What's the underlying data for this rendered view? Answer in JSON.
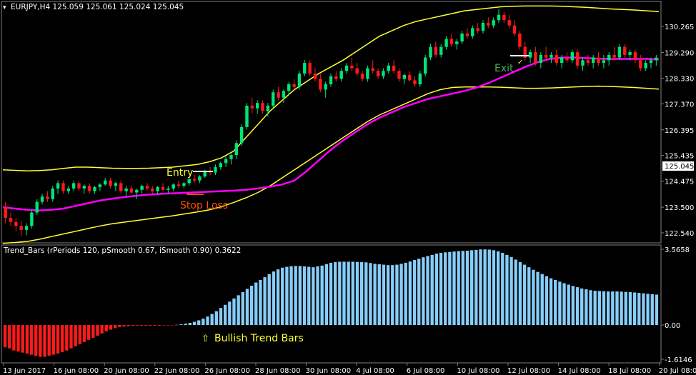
{
  "chart_data": [
    {
      "type": "candlestick",
      "header": "EURJPY,H4  125.059 125.061 125.024 125.045",
      "current_price": "125.045",
      "y_ticks": [
        "130.265",
        "129.290",
        "128.330",
        "127.370",
        "126.395",
        "125.435",
        "124.475",
        "123.500",
        "122.540"
      ],
      "y_tick_values": [
        130.265,
        129.29,
        128.33,
        127.37,
        126.395,
        125.435,
        124.475,
        123.5,
        122.54
      ],
      "ylim": [
        122.4,
        131.0
      ],
      "annotations": [
        "Entry",
        "Stop Loss",
        "Exit"
      ],
      "candles": [
        [
          123.5,
          123.7,
          122.9,
          123.1
        ],
        [
          123.1,
          123.3,
          122.8,
          122.95
        ],
        [
          122.95,
          123.1,
          122.6,
          122.8
        ],
        [
          122.8,
          123.0,
          122.4,
          122.65
        ],
        [
          122.65,
          122.9,
          122.45,
          122.8
        ],
        [
          122.8,
          123.4,
          122.7,
          123.3
        ],
        [
          123.3,
          123.8,
          123.2,
          123.7
        ],
        [
          123.7,
          124.0,
          123.6,
          123.9
        ],
        [
          123.9,
          124.1,
          123.7,
          123.8
        ],
        [
          123.8,
          124.3,
          123.7,
          124.2
        ],
        [
          124.2,
          124.5,
          124.0,
          124.4
        ],
        [
          124.4,
          124.5,
          124.0,
          124.1
        ],
        [
          124.1,
          124.3,
          124.0,
          124.2
        ],
        [
          124.2,
          124.5,
          124.1,
          124.4
        ],
        [
          124.4,
          124.5,
          124.1,
          124.2
        ],
        [
          124.2,
          124.35,
          124.0,
          124.3
        ],
        [
          124.3,
          124.4,
          124.0,
          124.1
        ],
        [
          124.1,
          124.3,
          124.0,
          124.25
        ],
        [
          124.25,
          124.4,
          124.1,
          124.35
        ],
        [
          124.35,
          124.6,
          124.3,
          124.5
        ],
        [
          124.5,
          124.6,
          124.2,
          124.3
        ],
        [
          124.3,
          124.45,
          124.1,
          124.4
        ],
        [
          124.4,
          124.5,
          124.0,
          124.1
        ],
        [
          124.1,
          124.3,
          123.9,
          124.2
        ],
        [
          124.2,
          124.3,
          124.0,
          124.05
        ],
        [
          124.05,
          124.2,
          123.8,
          124.15
        ],
        [
          124.15,
          124.35,
          124.0,
          124.3
        ],
        [
          124.3,
          124.4,
          124.1,
          124.2
        ],
        [
          124.2,
          124.3,
          124.0,
          124.1
        ],
        [
          124.1,
          124.3,
          124.0,
          124.25
        ],
        [
          124.25,
          124.4,
          124.1,
          124.15
        ],
        [
          124.15,
          124.3,
          124.0,
          124.2
        ],
        [
          124.2,
          124.4,
          124.1,
          124.35
        ],
        [
          124.35,
          124.5,
          124.2,
          124.3
        ],
        [
          124.3,
          124.45,
          124.2,
          124.4
        ],
        [
          124.4,
          124.6,
          124.3,
          124.55
        ],
        [
          124.55,
          124.7,
          124.4,
          124.5
        ],
        [
          124.5,
          124.7,
          124.4,
          124.65
        ],
        [
          124.65,
          124.9,
          124.6,
          124.85
        ],
        [
          124.85,
          125.0,
          124.7,
          124.8
        ],
        [
          124.8,
          125.1,
          124.7,
          125.0
        ],
        [
          125.0,
          125.2,
          124.9,
          125.15
        ],
        [
          125.15,
          125.4,
          125.0,
          125.3
        ],
        [
          125.3,
          125.5,
          125.1,
          125.45
        ],
        [
          125.45,
          126.0,
          125.3,
          125.9
        ],
        [
          125.9,
          126.6,
          125.8,
          126.5
        ],
        [
          126.5,
          127.4,
          126.4,
          127.3
        ],
        [
          127.3,
          127.6,
          127.0,
          127.2
        ],
        [
          127.2,
          127.5,
          127.0,
          127.4
        ],
        [
          127.4,
          127.5,
          127.0,
          127.1
        ],
        [
          127.1,
          127.4,
          126.9,
          127.3
        ],
        [
          127.3,
          127.9,
          127.2,
          127.8
        ],
        [
          127.8,
          128.0,
          127.5,
          127.6
        ],
        [
          127.6,
          127.9,
          127.4,
          127.85
        ],
        [
          127.85,
          128.2,
          127.7,
          128.1
        ],
        [
          128.1,
          128.3,
          127.9,
          128.0
        ],
        [
          128.0,
          128.6,
          127.9,
          128.5
        ],
        [
          128.5,
          129.0,
          128.4,
          128.9
        ],
        [
          128.9,
          129.0,
          128.4,
          128.5
        ],
        [
          128.5,
          128.7,
          128.2,
          128.3
        ],
        [
          128.3,
          128.5,
          127.8,
          127.9
        ],
        [
          127.9,
          128.2,
          127.6,
          128.1
        ],
        [
          128.1,
          128.5,
          128.0,
          128.4
        ],
        [
          128.4,
          128.6,
          128.2,
          128.3
        ],
        [
          128.3,
          128.7,
          128.2,
          128.6
        ],
        [
          128.6,
          128.9,
          128.5,
          128.8
        ],
        [
          128.8,
          129.1,
          128.6,
          128.7
        ],
        [
          128.7,
          128.9,
          128.4,
          128.5
        ],
        [
          128.5,
          128.6,
          128.2,
          128.3
        ],
        [
          128.3,
          128.8,
          128.2,
          128.7
        ],
        [
          128.7,
          129.0,
          128.5,
          128.6
        ],
        [
          128.6,
          128.7,
          128.3,
          128.4
        ],
        [
          128.4,
          128.7,
          128.3,
          128.6
        ],
        [
          128.6,
          128.9,
          128.5,
          128.8
        ],
        [
          128.8,
          129.0,
          128.5,
          128.6
        ],
        [
          128.6,
          128.7,
          128.2,
          128.3
        ],
        [
          128.3,
          128.5,
          128.1,
          128.45
        ],
        [
          128.45,
          128.6,
          128.2,
          128.25
        ],
        [
          128.25,
          128.4,
          128.0,
          128.1
        ],
        [
          128.1,
          128.6,
          128.0,
          128.5
        ],
        [
          128.5,
          129.2,
          128.4,
          129.1
        ],
        [
          129.1,
          129.6,
          129.0,
          129.5
        ],
        [
          129.5,
          129.7,
          129.1,
          129.2
        ],
        [
          129.2,
          129.6,
          129.1,
          129.5
        ],
        [
          129.5,
          129.9,
          129.4,
          129.8
        ],
        [
          129.8,
          130.0,
          129.5,
          129.6
        ],
        [
          129.6,
          129.8,
          129.4,
          129.7
        ],
        [
          129.7,
          130.1,
          129.6,
          130.0
        ],
        [
          130.0,
          130.2,
          129.8,
          129.9
        ],
        [
          129.9,
          130.3,
          129.8,
          130.2
        ],
        [
          130.2,
          130.4,
          130.0,
          130.1
        ],
        [
          130.1,
          130.5,
          130.0,
          130.4
        ],
        [
          130.4,
          130.6,
          130.2,
          130.3
        ],
        [
          130.3,
          130.6,
          130.2,
          130.5
        ],
        [
          130.5,
          130.9,
          130.4,
          130.7
        ],
        [
          130.7,
          130.8,
          130.4,
          130.5
        ],
        [
          130.5,
          130.7,
          130.2,
          130.3
        ],
        [
          130.3,
          130.5,
          129.9,
          130.0
        ],
        [
          130.0,
          130.1,
          129.4,
          129.5
        ],
        [
          129.5,
          129.7,
          129.0,
          129.1
        ],
        [
          129.1,
          129.4,
          128.9,
          129.3
        ],
        [
          129.3,
          129.5,
          128.8,
          128.9
        ],
        [
          128.9,
          129.3,
          128.7,
          129.2
        ],
        [
          129.2,
          129.5,
          129.0,
          129.1
        ],
        [
          129.1,
          129.3,
          128.9,
          129.2
        ],
        [
          129.2,
          129.4,
          128.8,
          128.9
        ],
        [
          128.9,
          129.2,
          128.7,
          129.1
        ],
        [
          129.1,
          129.3,
          128.9,
          129.0
        ],
        [
          129.0,
          129.4,
          128.9,
          129.3
        ],
        [
          129.3,
          129.4,
          128.7,
          128.8
        ],
        [
          128.8,
          129.1,
          128.6,
          129.0
        ],
        [
          129.0,
          129.2,
          128.8,
          128.9
        ],
        [
          128.9,
          129.2,
          128.7,
          129.1
        ],
        [
          129.1,
          129.3,
          128.8,
          128.9
        ],
        [
          128.9,
          129.2,
          128.7,
          129.0
        ],
        [
          129.0,
          129.3,
          128.8,
          129.2
        ],
        [
          129.2,
          129.5,
          129.0,
          129.1
        ],
        [
          129.1,
          129.6,
          129.0,
          129.5
        ],
        [
          129.5,
          129.6,
          129.1,
          129.2
        ],
        [
          129.2,
          129.4,
          129.0,
          129.3
        ],
        [
          129.3,
          129.4,
          128.9,
          129.0
        ],
        [
          129.0,
          129.2,
          128.6,
          128.7
        ],
        [
          128.7,
          129.0,
          128.6,
          128.9
        ],
        [
          128.9,
          129.1,
          128.7,
          129.0
        ],
        [
          129.0,
          129.2,
          128.8,
          129.1
        ]
      ],
      "ma_line": [
        123.5,
        123.45,
        123.4,
        123.38,
        123.4,
        123.45,
        123.55,
        123.65,
        123.75,
        123.82,
        123.88,
        123.93,
        123.97,
        124.0,
        124.02,
        124.04,
        124.06,
        124.08,
        124.1,
        124.12,
        124.15,
        124.2,
        124.27,
        124.35,
        124.5,
        124.85,
        125.25,
        125.65,
        126.0,
        126.3,
        126.6,
        126.85,
        127.05,
        127.25,
        127.4,
        127.55,
        127.65,
        127.75,
        127.85,
        127.98,
        128.15,
        128.35,
        128.55,
        128.75,
        128.92,
        129.05,
        129.1,
        129.1,
        129.08,
        129.06,
        129.05,
        129.05,
        129.05,
        129.05,
        129.03
      ],
      "upper_band": [
        124.9,
        124.88,
        124.86,
        124.87,
        124.9,
        124.95,
        125.0,
        125.0,
        124.98,
        124.96,
        124.95,
        124.95,
        124.96,
        124.98,
        125.0,
        125.05,
        125.1,
        125.2,
        125.35,
        125.6,
        126.1,
        126.6,
        127.1,
        127.5,
        127.9,
        128.2,
        128.5,
        128.75,
        129.0,
        129.3,
        129.6,
        129.9,
        130.1,
        130.3,
        130.45,
        130.55,
        130.65,
        130.75,
        130.85,
        130.9,
        130.95,
        131.0,
        131.02,
        131.03,
        131.03,
        131.03,
        131.02,
        131.0,
        130.98,
        130.95,
        130.92,
        130.9,
        130.88,
        130.85,
        130.82
      ],
      "lower_band": [
        122.15,
        122.18,
        122.22,
        122.3,
        122.4,
        122.5,
        122.6,
        122.7,
        122.8,
        122.88,
        122.94,
        123.0,
        123.06,
        123.12,
        123.18,
        123.25,
        123.32,
        123.4,
        123.52,
        123.68,
        123.85,
        124.05,
        124.3,
        124.6,
        124.9,
        125.2,
        125.5,
        125.8,
        126.1,
        126.4,
        126.7,
        126.95,
        127.15,
        127.35,
        127.55,
        127.75,
        127.9,
        127.98,
        128.0,
        128.0,
        128.0,
        127.99,
        127.97,
        127.95,
        127.95,
        127.96,
        127.98,
        128.0,
        128.02,
        128.03,
        128.02,
        128.0,
        127.98,
        127.95,
        127.92
      ]
    },
    {
      "type": "bar",
      "title": "Trend_Bars  (rPeriods 120, pSmooth 0.67, iSmooth 0.90)  0.3622",
      "y_ticks": [
        "3.5658",
        "0.00",
        "-1.6146"
      ],
      "y_tick_values": [
        3.5658,
        0,
        -1.6146
      ],
      "ylim": [
        -1.6146,
        3.5658
      ],
      "annotation": "Bullish Trend Bars",
      "x_labels": [
        "13 Jun 2017",
        "16 Jun 08:00",
        "20 Jun 08:00",
        "22 Jun 08:00",
        "26 Jun 08:00",
        "28 Jun 08:00",
        "30 Jun 08:00",
        "4 Jul 08:00",
        "6 Jul 08:00",
        "10 Jul 08:00",
        "12 Jul 08:00",
        "14 Jul 08:00",
        "18 Jul 08:00",
        "20 Jul 08:00"
      ],
      "values": [
        -1.05,
        -1.1,
        -1.2,
        -1.25,
        -1.3,
        -1.35,
        -1.4,
        -1.45,
        -1.5,
        -1.5,
        -1.45,
        -1.4,
        -1.35,
        -1.28,
        -1.2,
        -1.1,
        -1.0,
        -0.9,
        -0.8,
        -0.7,
        -0.6,
        -0.5,
        -0.4,
        -0.3,
        -0.22,
        -0.15,
        -0.1,
        -0.07,
        -0.05,
        -0.04,
        -0.03,
        -0.03,
        -0.03,
        -0.03,
        -0.03,
        -0.03,
        -0.02,
        -0.02,
        -0.01,
        0.01,
        0.03,
        0.06,
        0.1,
        0.15,
        0.22,
        0.3,
        0.4,
        0.52,
        0.65,
        0.8,
        0.95,
        1.1,
        1.25,
        1.4,
        1.55,
        1.7,
        1.85,
        2.0,
        2.12,
        2.25,
        2.4,
        2.52,
        2.62,
        2.7,
        2.74,
        2.77,
        2.78,
        2.78,
        2.76,
        2.74,
        2.72,
        2.76,
        2.8,
        2.87,
        2.93,
        2.96,
        2.98,
        2.98,
        2.98,
        2.98,
        2.97,
        2.96,
        2.95,
        2.92,
        2.88,
        2.86,
        2.84,
        2.82,
        2.82,
        2.84,
        2.88,
        2.93,
        2.99,
        3.06,
        3.12,
        3.19,
        3.25,
        3.3,
        3.36,
        3.4,
        3.42,
        3.44,
        3.46,
        3.48,
        3.49,
        3.5,
        3.52,
        3.54,
        3.56,
        3.56,
        3.55,
        3.52,
        3.47,
        3.4,
        3.3,
        3.2,
        3.08,
        2.96,
        2.84,
        2.72,
        2.6,
        2.5,
        2.4,
        2.3,
        2.2,
        2.12,
        2.04,
        1.97,
        1.9,
        1.84,
        1.78,
        1.72,
        1.68,
        1.64,
        1.61,
        1.6,
        1.59,
        1.58,
        1.58,
        1.58,
        1.57,
        1.56,
        1.55,
        1.53,
        1.51,
        1.49,
        1.47,
        1.45,
        1.43
      ]
    }
  ],
  "colors": {
    "bull_candle": "#00e676",
    "bear_candle": "#ff1a1a",
    "ma_line": "#ff00ff",
    "bands": "#ffff33",
    "bar_positive": "#87cefa",
    "bar_negative": "#ff1a1a",
    "entry_label": "#ffff33",
    "stop_label": "#ff4d00",
    "exit_label": "#4caf50",
    "text": "#ffffff"
  }
}
